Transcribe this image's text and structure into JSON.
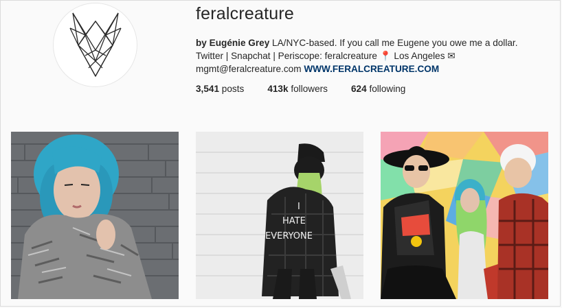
{
  "profile": {
    "username": "feralcreature",
    "bio": {
      "name": "by Eugénie Grey",
      "line1_rest": " LA/NYC-based. If you call me Eugene you owe me a dollar.",
      "line2": "Twitter | Snapchat | Periscope: feralcreature 📍 Los Angeles ✉",
      "email": "mgmt@feralcreature.com",
      "website": "WWW.FERALCREATURE.COM"
    },
    "stats": {
      "posts_count": "3,541",
      "posts_label": " posts",
      "followers_count": "413k",
      "followers_label": " followers",
      "following_count": "624",
      "following_label": " following"
    }
  },
  "posts": [
    {
      "subject": "woman-blue-hair-knit-sweater-brick-wall"
    },
    {
      "subject": "person-black-flannel-shirt-back",
      "shirt_text": [
        "I",
        "HATE",
        "EVERYONE"
      ]
    },
    {
      "subject": "three-people-colorful-mural"
    }
  ],
  "colors": {
    "link": "#003569",
    "text": "#262626",
    "background": "#fafafa"
  }
}
